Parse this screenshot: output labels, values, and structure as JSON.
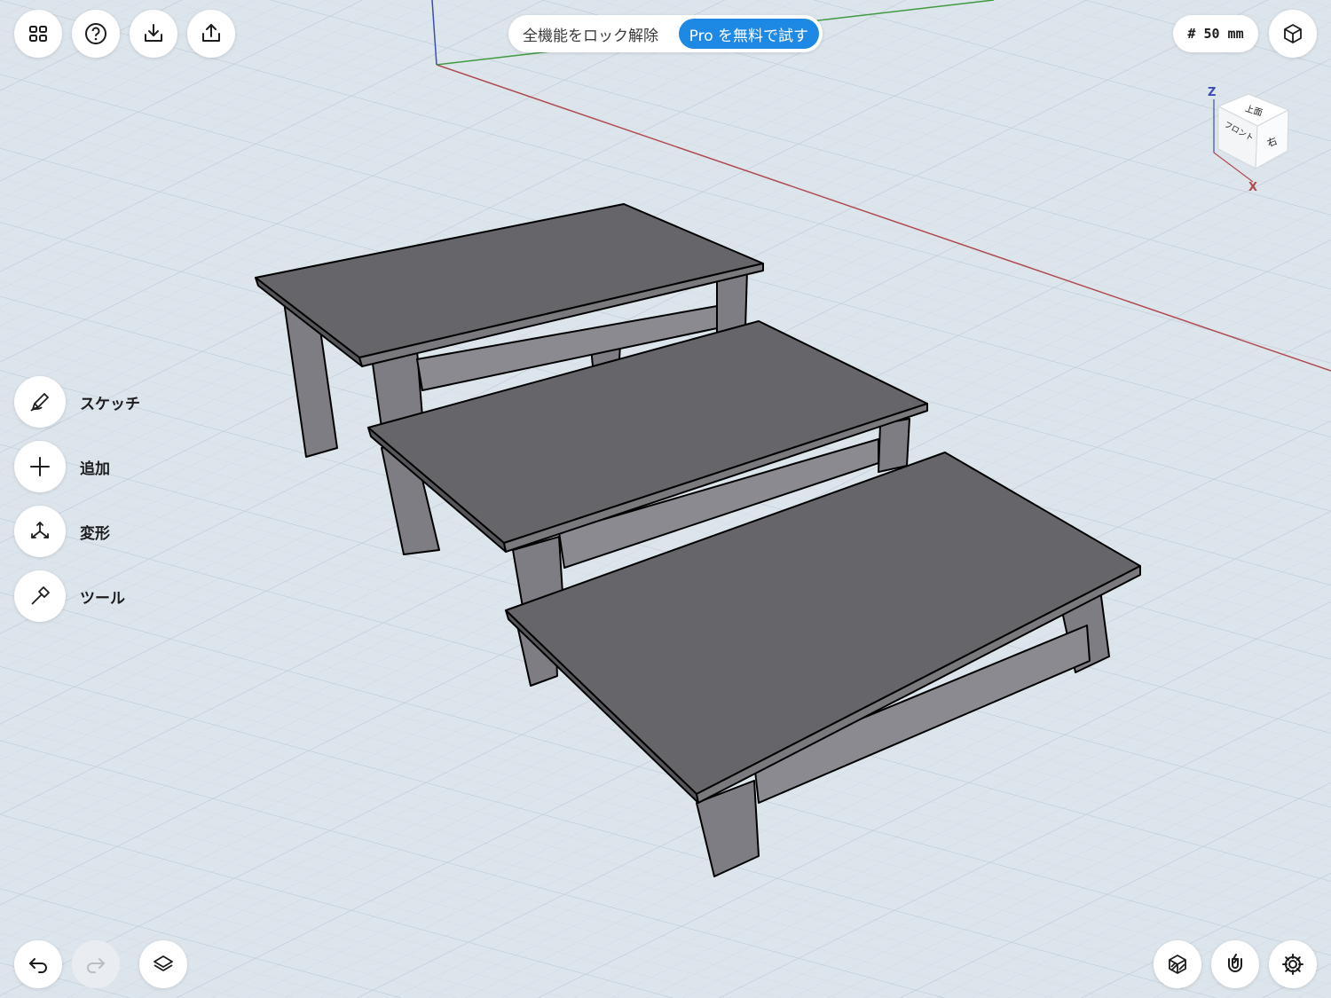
{
  "toolbar_top_left": {
    "icons": [
      "grid-icon",
      "help-icon",
      "import-icon",
      "export-icon"
    ]
  },
  "banner": {
    "text": "全機能をロック解除",
    "pro_label": "Pro を無料で試す",
    "pro_color": "#1e88e5"
  },
  "grid": {
    "size_label": "# 50 mm"
  },
  "view_cube": {
    "top": "上面",
    "front": "フロント",
    "right": "右",
    "axis_z": "Z",
    "axis_x": "X"
  },
  "tools": [
    {
      "label": "スケッチ",
      "icon": "pencil-icon"
    },
    {
      "label": "追加",
      "icon": "plus-icon"
    },
    {
      "label": "変形",
      "icon": "transform-icon"
    },
    {
      "label": "ツール",
      "icon": "hammer-icon"
    }
  ],
  "bottom_left_icons": [
    "undo-icon",
    "redo-icon",
    "layers-icon"
  ],
  "bottom_right_icons": [
    "render-style-icon",
    "snap-magnet-icon",
    "settings-gear-icon"
  ],
  "colors": {
    "background": "#dde5ec",
    "model_top": "#66656a",
    "model_side": "#7d7d83",
    "axis_x": "#b04a4f",
    "axis_y": "#3f9a3f",
    "axis_z": "#3b4db3"
  }
}
